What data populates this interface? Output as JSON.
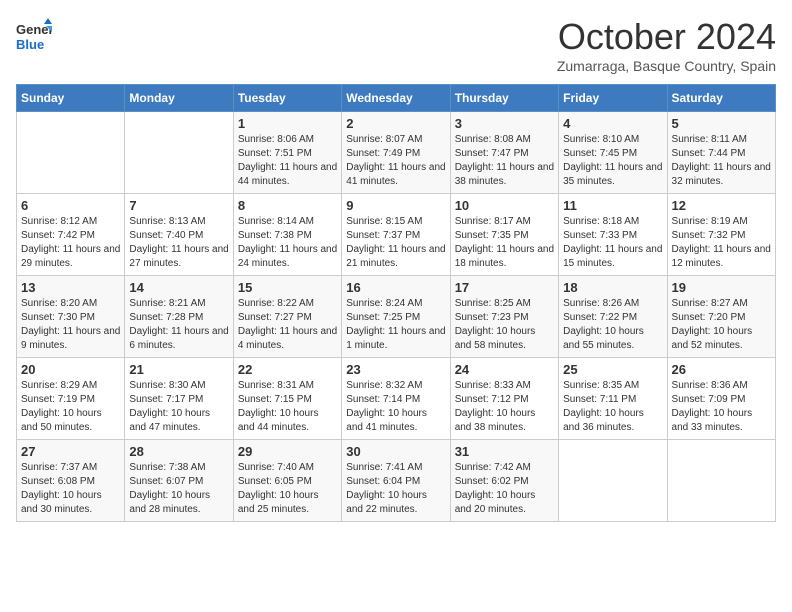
{
  "logo": {
    "line1": "General",
    "line2": "Blue"
  },
  "title": "October 2024",
  "subtitle": "Zumarraga, Basque Country, Spain",
  "days_of_week": [
    "Sunday",
    "Monday",
    "Tuesday",
    "Wednesday",
    "Thursday",
    "Friday",
    "Saturday"
  ],
  "weeks": [
    [
      {
        "num": "",
        "sunrise": "",
        "sunset": "",
        "daylight": ""
      },
      {
        "num": "",
        "sunrise": "",
        "sunset": "",
        "daylight": ""
      },
      {
        "num": "1",
        "sunrise": "Sunrise: 8:06 AM",
        "sunset": "Sunset: 7:51 PM",
        "daylight": "Daylight: 11 hours and 44 minutes."
      },
      {
        "num": "2",
        "sunrise": "Sunrise: 8:07 AM",
        "sunset": "Sunset: 7:49 PM",
        "daylight": "Daylight: 11 hours and 41 minutes."
      },
      {
        "num": "3",
        "sunrise": "Sunrise: 8:08 AM",
        "sunset": "Sunset: 7:47 PM",
        "daylight": "Daylight: 11 hours and 38 minutes."
      },
      {
        "num": "4",
        "sunrise": "Sunrise: 8:10 AM",
        "sunset": "Sunset: 7:45 PM",
        "daylight": "Daylight: 11 hours and 35 minutes."
      },
      {
        "num": "5",
        "sunrise": "Sunrise: 8:11 AM",
        "sunset": "Sunset: 7:44 PM",
        "daylight": "Daylight: 11 hours and 32 minutes."
      }
    ],
    [
      {
        "num": "6",
        "sunrise": "Sunrise: 8:12 AM",
        "sunset": "Sunset: 7:42 PM",
        "daylight": "Daylight: 11 hours and 29 minutes."
      },
      {
        "num": "7",
        "sunrise": "Sunrise: 8:13 AM",
        "sunset": "Sunset: 7:40 PM",
        "daylight": "Daylight: 11 hours and 27 minutes."
      },
      {
        "num": "8",
        "sunrise": "Sunrise: 8:14 AM",
        "sunset": "Sunset: 7:38 PM",
        "daylight": "Daylight: 11 hours and 24 minutes."
      },
      {
        "num": "9",
        "sunrise": "Sunrise: 8:15 AM",
        "sunset": "Sunset: 7:37 PM",
        "daylight": "Daylight: 11 hours and 21 minutes."
      },
      {
        "num": "10",
        "sunrise": "Sunrise: 8:17 AM",
        "sunset": "Sunset: 7:35 PM",
        "daylight": "Daylight: 11 hours and 18 minutes."
      },
      {
        "num": "11",
        "sunrise": "Sunrise: 8:18 AM",
        "sunset": "Sunset: 7:33 PM",
        "daylight": "Daylight: 11 hours and 15 minutes."
      },
      {
        "num": "12",
        "sunrise": "Sunrise: 8:19 AM",
        "sunset": "Sunset: 7:32 PM",
        "daylight": "Daylight: 11 hours and 12 minutes."
      }
    ],
    [
      {
        "num": "13",
        "sunrise": "Sunrise: 8:20 AM",
        "sunset": "Sunset: 7:30 PM",
        "daylight": "Daylight: 11 hours and 9 minutes."
      },
      {
        "num": "14",
        "sunrise": "Sunrise: 8:21 AM",
        "sunset": "Sunset: 7:28 PM",
        "daylight": "Daylight: 11 hours and 6 minutes."
      },
      {
        "num": "15",
        "sunrise": "Sunrise: 8:22 AM",
        "sunset": "Sunset: 7:27 PM",
        "daylight": "Daylight: 11 hours and 4 minutes."
      },
      {
        "num": "16",
        "sunrise": "Sunrise: 8:24 AM",
        "sunset": "Sunset: 7:25 PM",
        "daylight": "Daylight: 11 hours and 1 minute."
      },
      {
        "num": "17",
        "sunrise": "Sunrise: 8:25 AM",
        "sunset": "Sunset: 7:23 PM",
        "daylight": "Daylight: 10 hours and 58 minutes."
      },
      {
        "num": "18",
        "sunrise": "Sunrise: 8:26 AM",
        "sunset": "Sunset: 7:22 PM",
        "daylight": "Daylight: 10 hours and 55 minutes."
      },
      {
        "num": "19",
        "sunrise": "Sunrise: 8:27 AM",
        "sunset": "Sunset: 7:20 PM",
        "daylight": "Daylight: 10 hours and 52 minutes."
      }
    ],
    [
      {
        "num": "20",
        "sunrise": "Sunrise: 8:29 AM",
        "sunset": "Sunset: 7:19 PM",
        "daylight": "Daylight: 10 hours and 50 minutes."
      },
      {
        "num": "21",
        "sunrise": "Sunrise: 8:30 AM",
        "sunset": "Sunset: 7:17 PM",
        "daylight": "Daylight: 10 hours and 47 minutes."
      },
      {
        "num": "22",
        "sunrise": "Sunrise: 8:31 AM",
        "sunset": "Sunset: 7:15 PM",
        "daylight": "Daylight: 10 hours and 44 minutes."
      },
      {
        "num": "23",
        "sunrise": "Sunrise: 8:32 AM",
        "sunset": "Sunset: 7:14 PM",
        "daylight": "Daylight: 10 hours and 41 minutes."
      },
      {
        "num": "24",
        "sunrise": "Sunrise: 8:33 AM",
        "sunset": "Sunset: 7:12 PM",
        "daylight": "Daylight: 10 hours and 38 minutes."
      },
      {
        "num": "25",
        "sunrise": "Sunrise: 8:35 AM",
        "sunset": "Sunset: 7:11 PM",
        "daylight": "Daylight: 10 hours and 36 minutes."
      },
      {
        "num": "26",
        "sunrise": "Sunrise: 8:36 AM",
        "sunset": "Sunset: 7:09 PM",
        "daylight": "Daylight: 10 hours and 33 minutes."
      }
    ],
    [
      {
        "num": "27",
        "sunrise": "Sunrise: 7:37 AM",
        "sunset": "Sunset: 6:08 PM",
        "daylight": "Daylight: 10 hours and 30 minutes."
      },
      {
        "num": "28",
        "sunrise": "Sunrise: 7:38 AM",
        "sunset": "Sunset: 6:07 PM",
        "daylight": "Daylight: 10 hours and 28 minutes."
      },
      {
        "num": "29",
        "sunrise": "Sunrise: 7:40 AM",
        "sunset": "Sunset: 6:05 PM",
        "daylight": "Daylight: 10 hours and 25 minutes."
      },
      {
        "num": "30",
        "sunrise": "Sunrise: 7:41 AM",
        "sunset": "Sunset: 6:04 PM",
        "daylight": "Daylight: 10 hours and 22 minutes."
      },
      {
        "num": "31",
        "sunrise": "Sunrise: 7:42 AM",
        "sunset": "Sunset: 6:02 PM",
        "daylight": "Daylight: 10 hours and 20 minutes."
      },
      {
        "num": "",
        "sunrise": "",
        "sunset": "",
        "daylight": ""
      },
      {
        "num": "",
        "sunrise": "",
        "sunset": "",
        "daylight": ""
      }
    ]
  ]
}
